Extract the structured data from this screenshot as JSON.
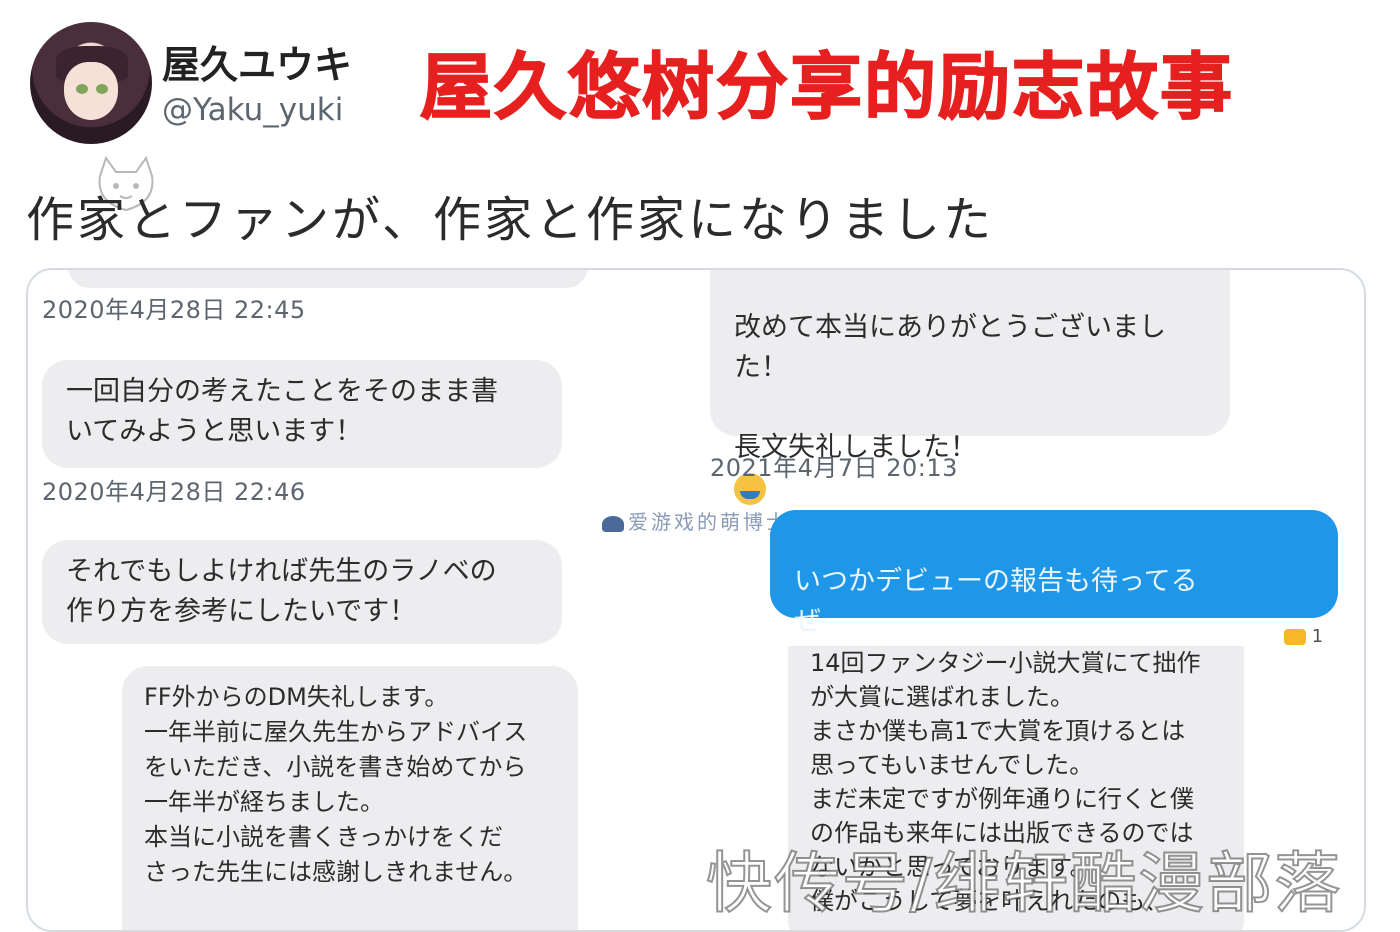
{
  "profile": {
    "display_name": "屋久ユウキ",
    "handle": "@Yaku_yuki"
  },
  "headline": "屋久悠树分享的励志故事",
  "tweet_text": "作家とファンが、作家と作家になりました",
  "dm": {
    "left": [
      {
        "timestamp": "2020年4月28日 22:45"
      },
      {
        "text": "一回自分の考えたことをそのまま書\nいてみようと思います！"
      },
      {
        "timestamp": "2020年4月28日 22:46"
      },
      {
        "text": "それでもしよければ先生のラノベの\n作り方を参考にしたいです！"
      },
      {
        "text": "FF外からのDM失礼します。\n一年半前に屋久先生からアドバイス\nをいただき、小説を書き始めてから\n一年半が経ちました。\n本当に小説を書くきっかけをくだ\nさった先生には感謝しきれません。"
      }
    ],
    "right": [
      {
        "text": "改めて本当にありがとうございまし\nた！\n\n長文失礼しました！"
      },
      {
        "timestamp": "2021年4月7日 20:13"
      },
      {
        "text": "いつかデビューの報告も待ってる\nぜ"
      },
      {
        "reaction_count": "1"
      },
      {
        "text": "14回ファンタジー小説大賞にて拙作\nが大賞に選ばれました。\nまさか僕も高1で大賞を頂けるとは\n思ってもいませんでした。\nまだ未定ですが例年通りに行くと僕\nの作品も来年には出版できるのでは\nないかと思っております。\n僕がこうして夢を叶えれたのも、"
      }
    ]
  },
  "watermarks": {
    "small": "爱游戏的萌博士",
    "big": "快传号/绯轩酷漫部落"
  },
  "colors": {
    "headline": "#e5201e",
    "sent_bubble": "#1e97e8",
    "received_bubble": "#ededf0"
  },
  "icons": [
    "avatar",
    "cat-watermark-icon",
    "sweat-smile-emoji-icon",
    "thumbs-up-emoji-icon",
    "graduation-cap-icon"
  ]
}
